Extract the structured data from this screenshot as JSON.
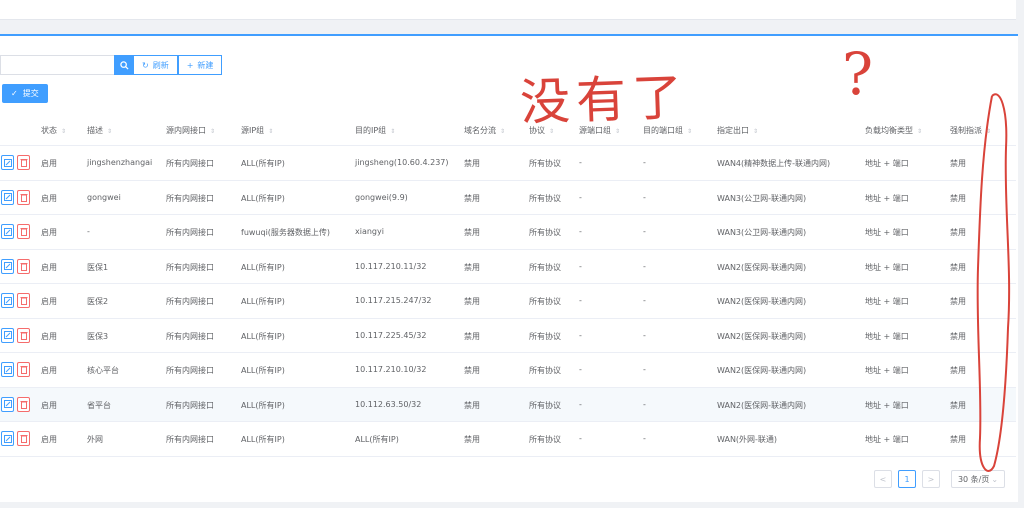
{
  "toolbar": {
    "search_placeholder": "",
    "refresh_label": "刷新",
    "new_label": "新建",
    "submit_label": "提交"
  },
  "columns": [
    "状态",
    "描述",
    "源内网接口",
    "源IP组",
    "目的IP组",
    "域名分流",
    "协议",
    "源端口组",
    "目的端口组",
    "指定出口",
    "负载均衡类型",
    "强制指派"
  ],
  "rows": [
    [
      "启用",
      "jingshenzhangai",
      "所有内网接口",
      "ALL(所有IP)",
      "jingsheng(10.60.4.237)",
      "禁用",
      "所有协议",
      "-",
      "-",
      "WAN4(精神数据上传-联通内网)",
      "地址 + 端口",
      "禁用"
    ],
    [
      "启用",
      "gongwei",
      "所有内网接口",
      "ALL(所有IP)",
      "gongwei(9.9)",
      "禁用",
      "所有协议",
      "-",
      "-",
      "WAN3(公卫网-联通内网)",
      "地址 + 端口",
      "禁用"
    ],
    [
      "启用",
      "-",
      "所有内网接口",
      "fuwuqi(服务器数据上传)",
      "xiangyi",
      "禁用",
      "所有协议",
      "-",
      "-",
      "WAN3(公卫网-联通内网)",
      "地址 + 端口",
      "禁用"
    ],
    [
      "启用",
      "医保1",
      "所有内网接口",
      "ALL(所有IP)",
      "10.117.210.11/32",
      "禁用",
      "所有协议",
      "-",
      "-",
      "WAN2(医保网-联通内网)",
      "地址 + 端口",
      "禁用"
    ],
    [
      "启用",
      "医保2",
      "所有内网接口",
      "ALL(所有IP)",
      "10.117.215.247/32",
      "禁用",
      "所有协议",
      "-",
      "-",
      "WAN2(医保网-联通内网)",
      "地址 + 端口",
      "禁用"
    ],
    [
      "启用",
      "医保3",
      "所有内网接口",
      "ALL(所有IP)",
      "10.117.225.45/32",
      "禁用",
      "所有协议",
      "-",
      "-",
      "WAN2(医保网-联通内网)",
      "地址 + 端口",
      "禁用"
    ],
    [
      "启用",
      "核心平台",
      "所有内网接口",
      "ALL(所有IP)",
      "10.117.210.10/32",
      "禁用",
      "所有协议",
      "-",
      "-",
      "WAN2(医保网-联通内网)",
      "地址 + 端口",
      "禁用"
    ],
    [
      "启用",
      "省平台",
      "所有内网接口",
      "ALL(所有IP)",
      "10.112.63.50/32",
      "禁用",
      "所有协议",
      "-",
      "-",
      "WAN2(医保网-联通内网)",
      "地址 + 端口",
      "禁用"
    ],
    [
      "启用",
      "外网",
      "所有内网接口",
      "ALL(所有IP)",
      "ALL(所有IP)",
      "禁用",
      "所有协议",
      "-",
      "-",
      "WAN(外网-联通)",
      "地址 + 端口",
      "禁用"
    ]
  ],
  "pagination": {
    "prev": "<",
    "current": "1",
    "next": ">",
    "page_size": "30 条/页"
  },
  "annotations": {
    "text": "没有了",
    "question": "?"
  },
  "colors": {
    "primary": "#409eff",
    "danger": "#f56c6c",
    "scribble": "#d9433a"
  }
}
